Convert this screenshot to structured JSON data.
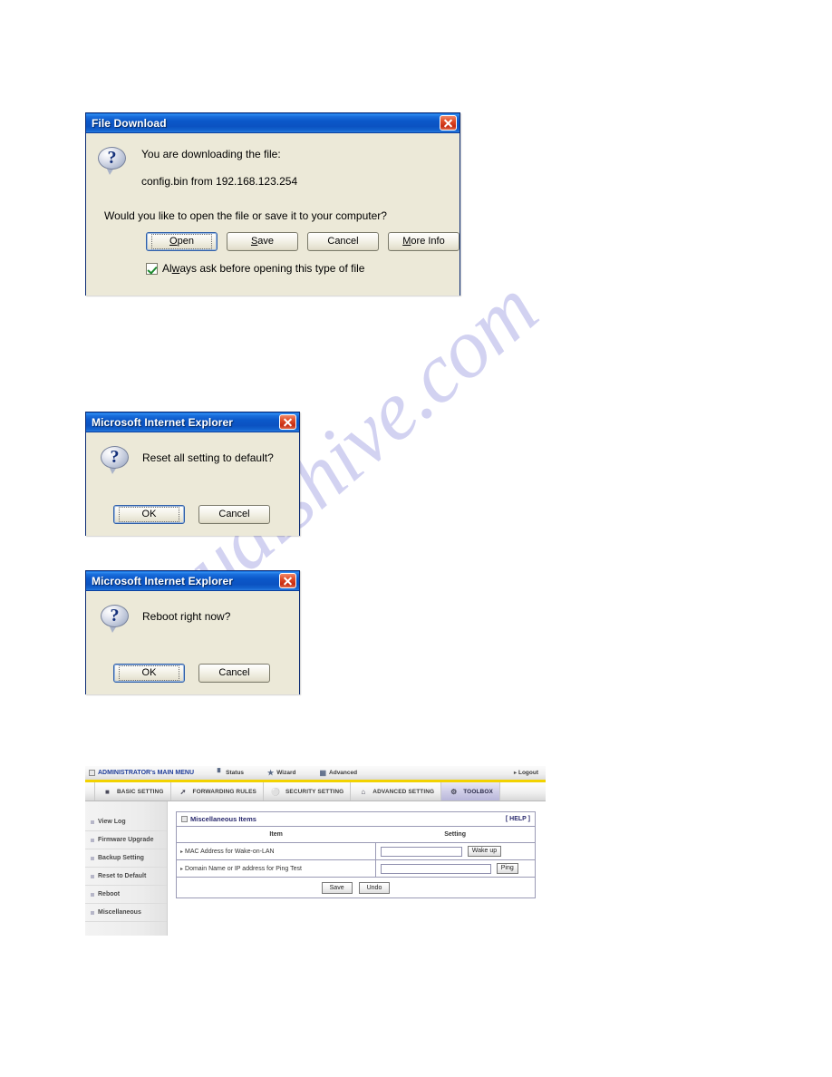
{
  "watermark": {
    "text": "manualshive.com"
  },
  "file_download_dialog": {
    "title": "File Download",
    "close_label": "Close",
    "icon": "question-bubble-icon",
    "line1": "You are downloading the file:",
    "line2": "config.bin from 192.168.123.254",
    "question": "Would you like to open the file or save it to your computer?",
    "buttons": [
      {
        "name": "open-button",
        "pre": "",
        "accel": "O",
        "post": "pen",
        "default": true
      },
      {
        "name": "save-button",
        "pre": "",
        "accel": "S",
        "post": "ave",
        "default": false
      },
      {
        "name": "cancel-button",
        "pre": "Cancel",
        "accel": "",
        "post": "",
        "default": false
      },
      {
        "name": "more-info-button",
        "pre": "",
        "accel": "M",
        "post": "ore Info",
        "default": false
      }
    ],
    "checkbox": {
      "checked": true,
      "pre": "Al",
      "accel": "w",
      "post": "ays ask before opening this type of file"
    }
  },
  "reset_dialog": {
    "title": "Microsoft Internet Explorer",
    "close_label": "Close",
    "icon": "question-bubble-icon",
    "message": "Reset all setting to default?",
    "ok_label": "OK",
    "cancel_label": "Cancel"
  },
  "reboot_dialog": {
    "title": "Microsoft Internet Explorer",
    "close_label": "Close",
    "icon": "question-bubble-icon",
    "message": "Reboot right now?",
    "ok_label": "OK",
    "cancel_label": "Cancel"
  },
  "router": {
    "topnav": {
      "brand": "ADMINISTRATOR's MAIN MENU",
      "status": "Status",
      "wizard": "Wizard",
      "advanced": "Advanced",
      "logout": "Logout"
    },
    "tabs": [
      {
        "label": "BASIC SETTING",
        "icon": "basic-setting-icon",
        "glyph": "◨",
        "active": false
      },
      {
        "label": "FORWARDING RULES",
        "icon": "forwarding-rules-icon",
        "glyph": "↗",
        "active": false
      },
      {
        "label": "SECURITY SETTING",
        "icon": "security-setting-icon",
        "glyph": "⊜",
        "active": false
      },
      {
        "label": "ADVANCED SETTING",
        "icon": "advanced-setting-icon",
        "glyph": "⌂",
        "active": false
      },
      {
        "label": "TOOLBOX",
        "icon": "toolbox-icon",
        "glyph": "⚙",
        "active": true
      }
    ],
    "sidebar": [
      {
        "label": "View Log"
      },
      {
        "label": "Firmware Upgrade"
      },
      {
        "label": "Backup Setting"
      },
      {
        "label": "Reset to Default"
      },
      {
        "label": "Reboot"
      },
      {
        "label": "Miscellaneous"
      }
    ],
    "panel": {
      "title": "Miscellaneous Items",
      "help": "[ HELP ]",
      "col_item": "Item",
      "col_setting": "Setting",
      "rows": [
        {
          "label": "MAC Address for Wake-on-LAN",
          "input_value": "",
          "input_placeholder": "",
          "button": "Wake up"
        },
        {
          "label": "Domain Name or IP address for Ping Test",
          "input_value": "",
          "input_placeholder": "",
          "button": "Ping"
        }
      ],
      "save_label": "Save",
      "undo_label": "Undo"
    }
  },
  "colors": {
    "titlebar_blue": "#0b58c9",
    "dialog_face": "#ece9d8",
    "close_red": "#c62b12",
    "nav_accent_yellow": "#f2d200",
    "panel_border": "#9a9ab5",
    "panel_title": "#2a2a6e",
    "watermark": "#cfcff0",
    "tab_active": "#cdcbe6"
  }
}
